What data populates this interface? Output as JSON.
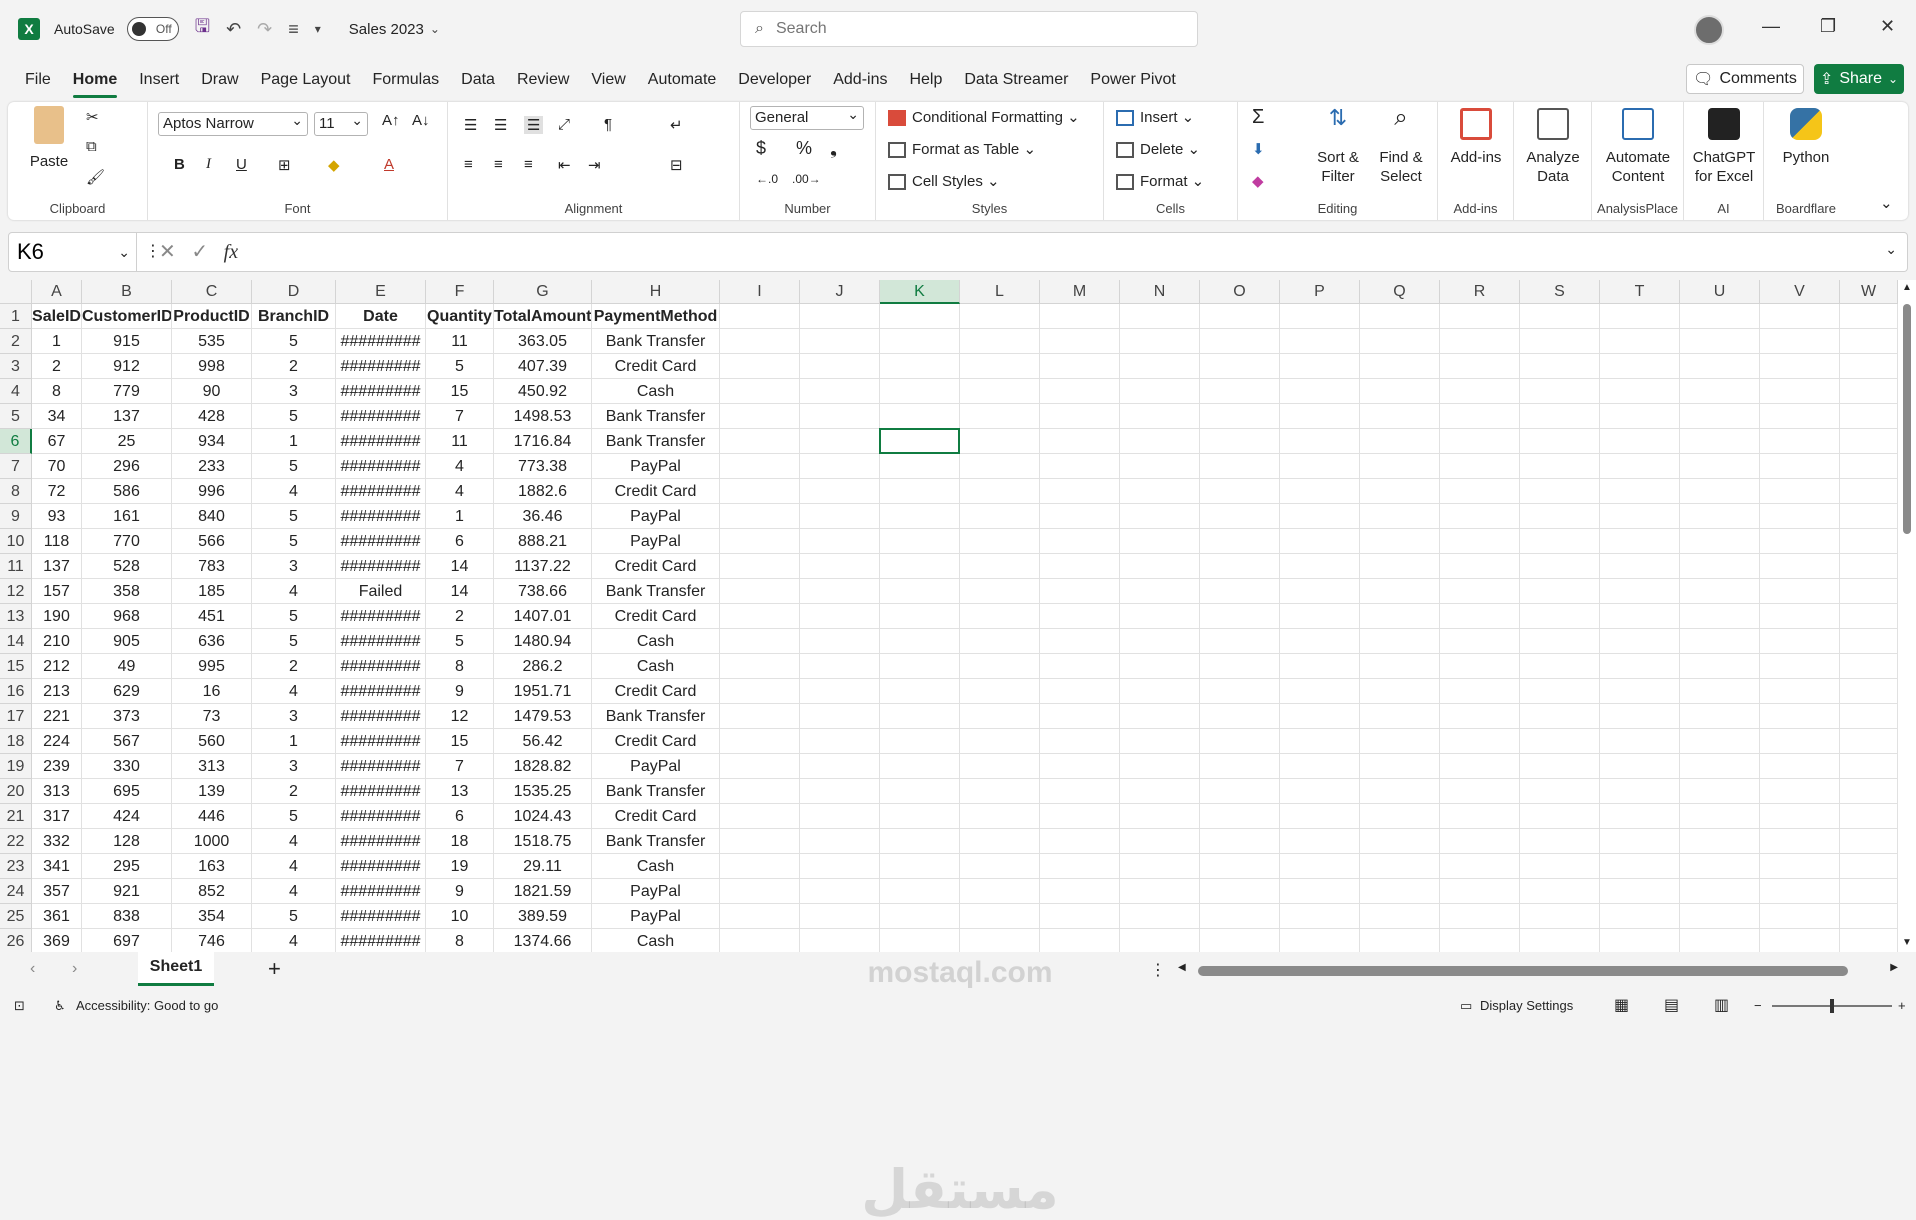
{
  "titlebar": {
    "autosave_label": "AutoSave",
    "autosave_state": "Off",
    "doc_title": "Sales 2023",
    "search_placeholder": "Search"
  },
  "menu": {
    "tabs": [
      "File",
      "Home",
      "Insert",
      "Draw",
      "Page Layout",
      "Formulas",
      "Data",
      "Review",
      "View",
      "Automate",
      "Developer",
      "Add-ins",
      "Help",
      "Data Streamer",
      "Power Pivot"
    ],
    "comments_label": "Comments",
    "share_label": "Share"
  },
  "ribbon": {
    "clipboard": {
      "paste": "Paste",
      "label": "Clipboard"
    },
    "font": {
      "name": "Aptos Narrow",
      "size": "11",
      "label": "Font",
      "bold": "B",
      "italic": "I",
      "underline": "U"
    },
    "alignment": {
      "label": "Alignment"
    },
    "number": {
      "format": "General",
      "label": "Number"
    },
    "styles": {
      "conditional": "Conditional Formatting",
      "format_table": "Format as Table",
      "cell_styles": "Cell Styles",
      "label": "Styles"
    },
    "cells": {
      "insert": "Insert",
      "delete": "Delete",
      "format": "Format",
      "label": "Cells"
    },
    "editing": {
      "sort_filter_1": "Sort &",
      "sort_filter_2": "Filter",
      "find_select_1": "Find &",
      "find_select_2": "Select",
      "label": "Editing"
    },
    "addins": {
      "button": "Add-ins",
      "label": "Add-ins"
    },
    "analyze": {
      "line1": "Analyze",
      "line2": "Data"
    },
    "analysisplace": {
      "line1": "Automate",
      "line2": "Content",
      "label": "AnalysisPlace"
    },
    "ai": {
      "line1": "ChatGPT",
      "line2": "for Excel",
      "label": "AI"
    },
    "boardflare": {
      "button": "Python",
      "label": "Boardflare"
    }
  },
  "formula_bar": {
    "name_box": "K6",
    "formula": ""
  },
  "grid": {
    "columns": [
      "A",
      "B",
      "C",
      "D",
      "E",
      "F",
      "G",
      "H",
      "I",
      "J",
      "K",
      "L",
      "M",
      "N",
      "O",
      "P",
      "Q",
      "R",
      "S",
      "T",
      "U",
      "V",
      "W"
    ],
    "selected_column": "K",
    "selected_row": 6,
    "header_row": [
      "SaleID",
      "CustomerID",
      "ProductID",
      "BranchID",
      "Date",
      "Quantity",
      "TotalAmount",
      "PaymentMethod"
    ],
    "rows": [
      [
        "1",
        "915",
        "535",
        "5",
        "#########",
        "11",
        "363.05",
        "Bank Transfer"
      ],
      [
        "2",
        "912",
        "998",
        "2",
        "#########",
        "5",
        "407.39",
        "Credit Card"
      ],
      [
        "8",
        "779",
        "90",
        "3",
        "#########",
        "15",
        "450.92",
        "Cash"
      ],
      [
        "34",
        "137",
        "428",
        "5",
        "#########",
        "7",
        "1498.53",
        "Bank Transfer"
      ],
      [
        "67",
        "25",
        "934",
        "1",
        "#########",
        "11",
        "1716.84",
        "Bank Transfer"
      ],
      [
        "70",
        "296",
        "233",
        "5",
        "#########",
        "4",
        "773.38",
        "PayPal"
      ],
      [
        "72",
        "586",
        "996",
        "4",
        "#########",
        "4",
        "1882.6",
        "Credit Card"
      ],
      [
        "93",
        "161",
        "840",
        "5",
        "#########",
        "1",
        "36.46",
        "PayPal"
      ],
      [
        "118",
        "770",
        "566",
        "5",
        "#########",
        "6",
        "888.21",
        "PayPal"
      ],
      [
        "137",
        "528",
        "783",
        "3",
        "#########",
        "14",
        "1137.22",
        "Credit Card"
      ],
      [
        "157",
        "358",
        "185",
        "4",
        "Failed",
        "14",
        "738.66",
        "Bank Transfer"
      ],
      [
        "190",
        "968",
        "451",
        "5",
        "#########",
        "2",
        "1407.01",
        "Credit Card"
      ],
      [
        "210",
        "905",
        "636",
        "5",
        "#########",
        "5",
        "1480.94",
        "Cash"
      ],
      [
        "212",
        "49",
        "995",
        "2",
        "#########",
        "8",
        "286.2",
        "Cash"
      ],
      [
        "213",
        "629",
        "16",
        "4",
        "#########",
        "9",
        "1951.71",
        "Credit Card"
      ],
      [
        "221",
        "373",
        "73",
        "3",
        "#########",
        "12",
        "1479.53",
        "Bank Transfer"
      ],
      [
        "224",
        "567",
        "560",
        "1",
        "#########",
        "15",
        "56.42",
        "Credit Card"
      ],
      [
        "239",
        "330",
        "313",
        "3",
        "#########",
        "7",
        "1828.82",
        "PayPal"
      ],
      [
        "313",
        "695",
        "139",
        "2",
        "#########",
        "13",
        "1535.25",
        "Bank Transfer"
      ],
      [
        "317",
        "424",
        "446",
        "5",
        "#########",
        "6",
        "1024.43",
        "Credit Card"
      ],
      [
        "332",
        "128",
        "1000",
        "4",
        "#########",
        "18",
        "1518.75",
        "Bank Transfer"
      ],
      [
        "341",
        "295",
        "163",
        "4",
        "#########",
        "19",
        "29.11",
        "Cash"
      ],
      [
        "357",
        "921",
        "852",
        "4",
        "#########",
        "9",
        "1821.59",
        "PayPal"
      ],
      [
        "361",
        "838",
        "354",
        "5",
        "#########",
        "10",
        "389.59",
        "PayPal"
      ],
      [
        "369",
        "697",
        "746",
        "4",
        "#########",
        "8",
        "1374.66",
        "Cash"
      ]
    ]
  },
  "sheets": {
    "active": "Sheet1"
  },
  "status": {
    "accessibility": "Accessibility: Good to go",
    "display_settings": "Display Settings"
  },
  "watermark": {
    "arabic": "مستقل",
    "latin": "mostaql.com"
  },
  "colors": {
    "accent": "#107c41",
    "selection_fill": "#d2e7d8"
  }
}
